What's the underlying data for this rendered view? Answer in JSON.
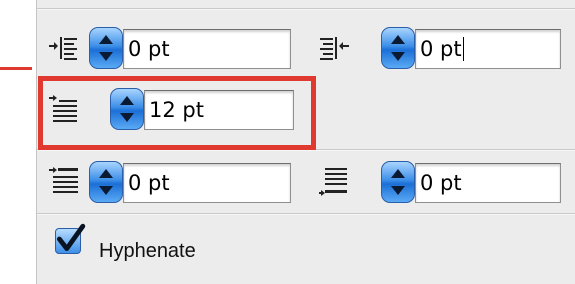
{
  "paragraph_panel": {
    "left_indent": {
      "value": "0 pt",
      "icon": "indent-left-icon"
    },
    "right_indent": {
      "value": "0 pt",
      "icon": "indent-right-icon"
    },
    "first_line_indent": {
      "value": "12 pt",
      "icon": "indent-first-line-icon"
    },
    "space_before": {
      "value": "0 pt",
      "icon": "space-before-icon"
    },
    "space_after": {
      "value": "0 pt",
      "icon": "space-after-icon"
    },
    "hyphenate": {
      "label": "Hyphenate",
      "checked": true,
      "icon": "checkmark-icon"
    }
  },
  "colors": {
    "highlight": "#e03a30",
    "stepper_blue": "#3d8fe8",
    "panel_bg": "#ececec"
  }
}
